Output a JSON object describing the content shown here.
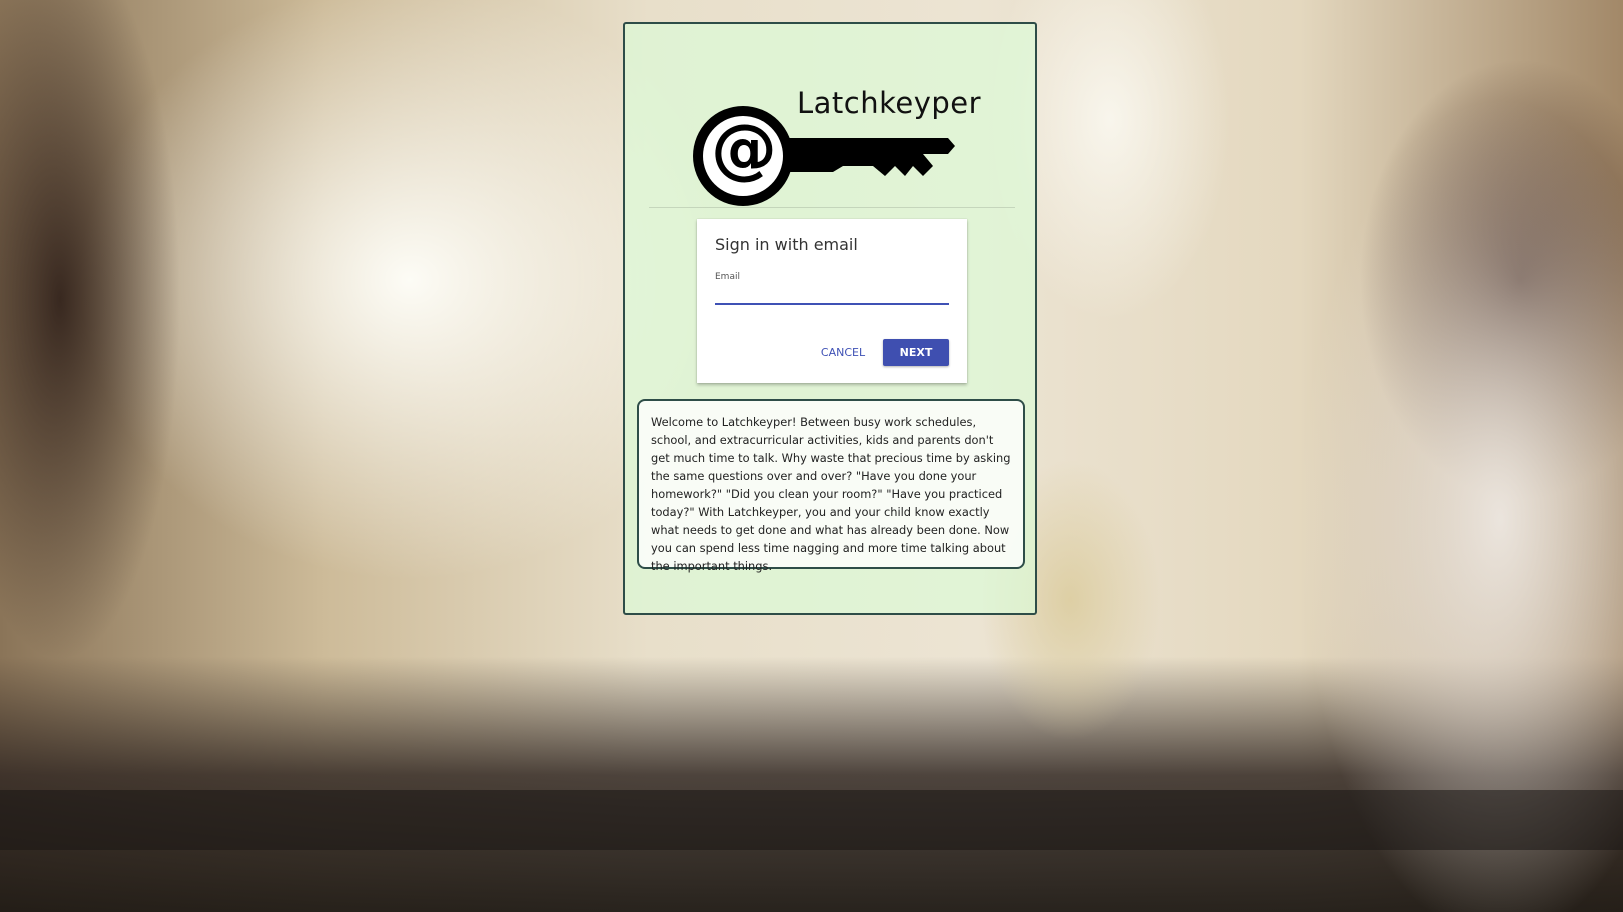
{
  "brand": {
    "name": "Latchkeyper",
    "logo_icon": "at-sign-key-icon"
  },
  "signin": {
    "title": "Sign in with email",
    "email_label": "Email",
    "email_value": "",
    "cancel_label": "CANCEL",
    "next_label": "NEXT"
  },
  "welcome": {
    "text": "Welcome to Latchkeyper! Between busy work schedules, school, and extracurricular activities, kids and parents don't get much time to talk. Why waste that precious time by asking the same questions over and over? \"Have you done your homework?\" \"Did you clean your room?\" \"Have you practiced today?\" With Latchkeyper, you and your child know exactly what needs to get done and what has already been done. Now you can spend less time nagging and more time talking about the important things."
  },
  "colors": {
    "accent": "#3f51b5",
    "panel_border": "#2e4d48",
    "panel_background": "#dcfad7"
  }
}
